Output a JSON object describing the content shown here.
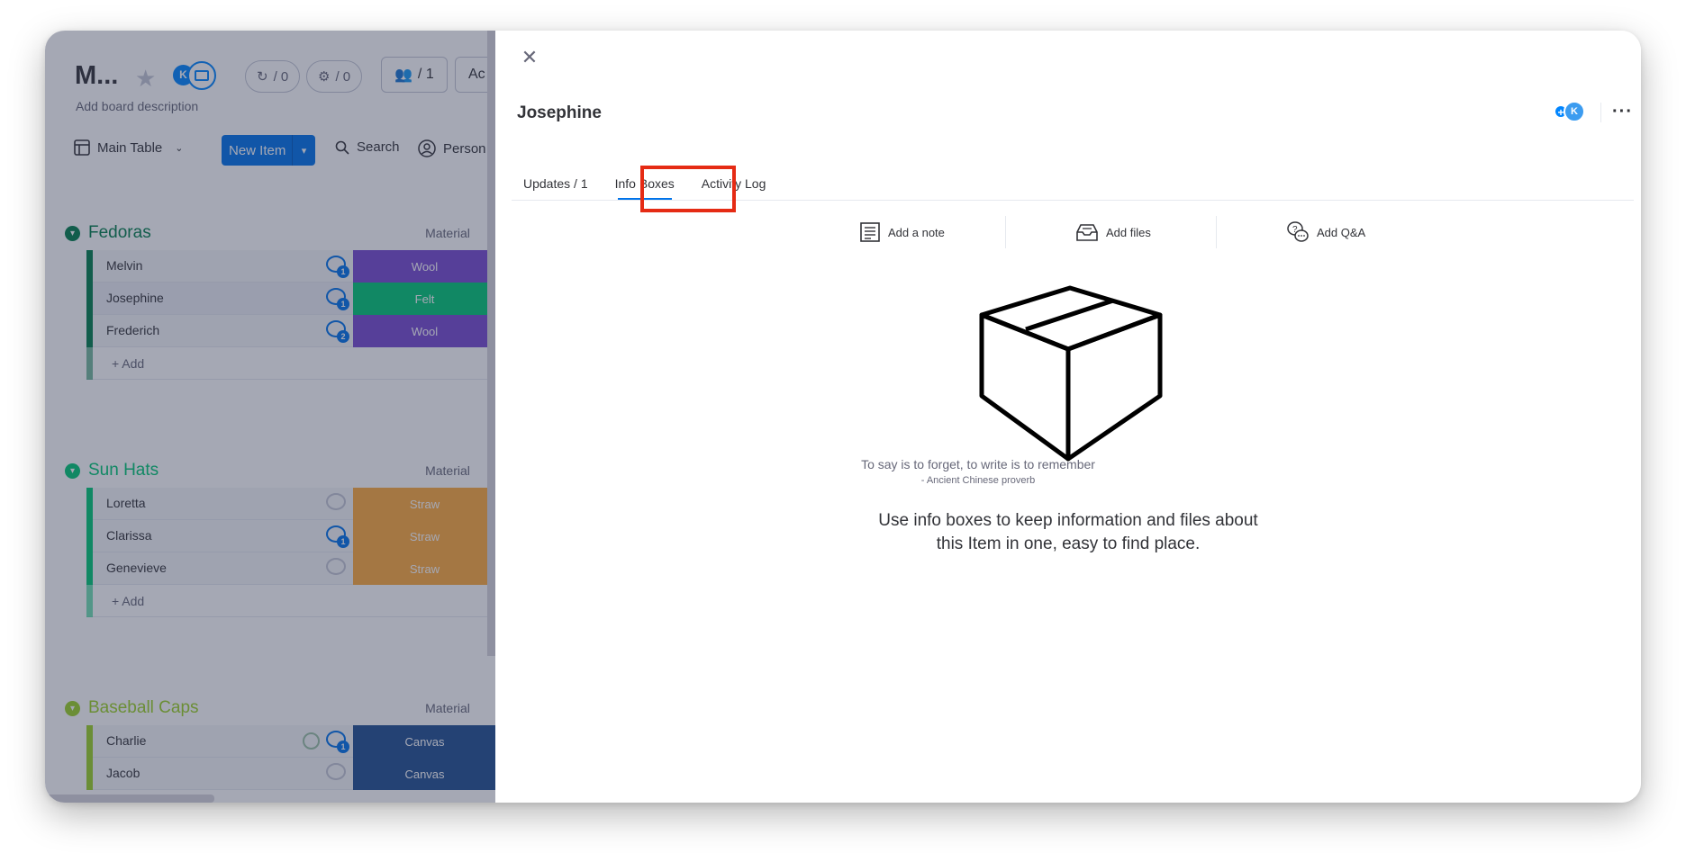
{
  "board": {
    "title": "M...",
    "description": "Add board description",
    "avatar_letter": "K",
    "stat_automations": "/ 0",
    "stat_integrations": "/ 0",
    "members_count": "/ 1",
    "activity_truncated": "Ac",
    "view_name": "Main Table",
    "new_item_label": "New Item",
    "search_label": "Search",
    "person_label": "Person",
    "add_label": "+ Add",
    "material_column": "Material",
    "groups": [
      {
        "name": "Fedoras",
        "color": "#037f4c",
        "rows": [
          {
            "name": "Melvin",
            "updates": "1",
            "material": "Wool",
            "material_color": "#784bd1"
          },
          {
            "name": "Josephine",
            "updates": "1",
            "material": "Felt",
            "material_color": "#00c875"
          },
          {
            "name": "Frederich",
            "updates": "2",
            "material": "Wool",
            "material_color": "#784bd1"
          }
        ]
      },
      {
        "name": "Sun Hats",
        "color": "#00c875",
        "rows": [
          {
            "name": "Loretta",
            "updates": "",
            "material": "Straw",
            "material_color": "#fdab3d"
          },
          {
            "name": "Clarissa",
            "updates": "1",
            "material": "Straw",
            "material_color": "#fdab3d"
          },
          {
            "name": "Genevieve",
            "updates": "",
            "material": "Straw",
            "material_color": "#fdab3d"
          }
        ]
      },
      {
        "name": "Baseball Caps",
        "color": "#9cd326",
        "rows": [
          {
            "name": "Charlie",
            "updates": "1",
            "material": "Canvas",
            "material_color": "#225091"
          },
          {
            "name": "Jacob",
            "updates": "",
            "material": "Canvas",
            "material_color": "#225091"
          }
        ]
      }
    ]
  },
  "panel": {
    "item_title": "Josephine",
    "subscriber_letter": "K",
    "tabs": [
      {
        "label": "Updates / 1"
      },
      {
        "label": "Info Boxes"
      },
      {
        "label": "Activity Log"
      }
    ],
    "actions": {
      "add_note": "Add a note",
      "add_files": "Add files",
      "add_qa": "Add Q&A"
    },
    "empty_state": {
      "quote": "To say is to forget, to write is to remember",
      "author": "- Ancient Chinese proverb",
      "description": "Use info boxes to keep information and files about this Item in one, easy to find place."
    },
    "accent_color": "#0073ea",
    "highlight_color": "#e52b14"
  }
}
